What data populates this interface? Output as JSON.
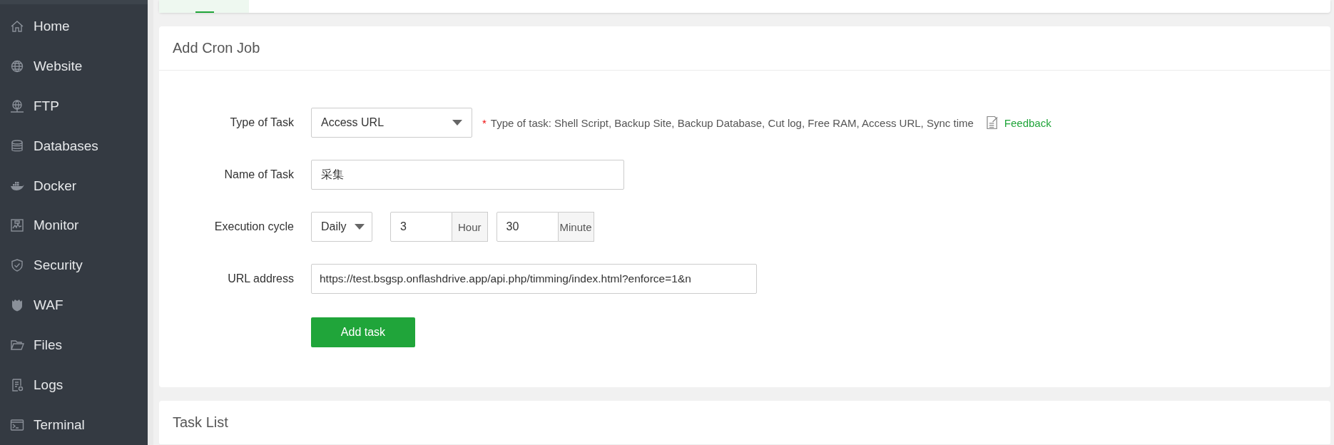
{
  "sidebar": {
    "items": [
      {
        "label": "Home"
      },
      {
        "label": "Website"
      },
      {
        "label": "FTP"
      },
      {
        "label": "Databases"
      },
      {
        "label": "Docker"
      },
      {
        "label": "Monitor"
      },
      {
        "label": "Security"
      },
      {
        "label": "WAF"
      },
      {
        "label": "Files"
      },
      {
        "label": "Logs"
      },
      {
        "label": "Terminal"
      }
    ]
  },
  "add_cron_job": {
    "title": "Add Cron Job",
    "type_of_task": {
      "label": "Type of Task",
      "value": "Access URL",
      "hint": "Type of task: Shell Script, Backup Site, Backup Database, Cut log, Free RAM, Access URL, Sync time",
      "required_mark": "*",
      "feedback": "Feedback"
    },
    "name_of_task": {
      "label": "Name of Task",
      "value": "采集"
    },
    "execution_cycle": {
      "label": "Execution cycle",
      "period": "Daily",
      "hour": "3",
      "hour_unit": "Hour",
      "minute": "30",
      "minute_unit": "Minute"
    },
    "url_address": {
      "label": "URL address",
      "value": "https://test.bsgsp.onflashdrive.app/api.php/timming/index.html?enforce=1&n"
    },
    "submit": "Add task"
  },
  "task_list": {
    "title": "Task List"
  }
}
